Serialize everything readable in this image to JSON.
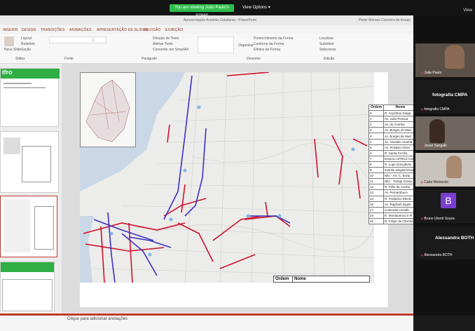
{
  "zoom": {
    "share_banner": "You are viewing João Paulo's screen",
    "view_options": "View Options",
    "view_corner": "View"
  },
  "window": {
    "doc_title": "Apresentação Avenida Cidadania - PowerPoint",
    "user_name": "Pieter Moraes Carneiro de Araujo"
  },
  "ribbon_tabs": [
    "INSERIR",
    "DESIGN",
    "TRANSIÇÕES",
    "ANIMAÇÕES",
    "APRESENTAÇÃO DE SLIDES",
    "REVISÃO",
    "EXIBIÇÃO"
  ],
  "ribbon": {
    "new_slide": "Novo Slide",
    "layout": "Layout",
    "reset": "Redefinir",
    "section": "Seção",
    "group_slides": "Slides",
    "group_font": "Fonte",
    "group_paragraph": "Parágrafo",
    "group_drawing": "Desenho",
    "group_editing": "Edição",
    "arrange": "Organizar",
    "find": "Localizar",
    "replace": "Substituir",
    "select": "Selecionar",
    "fill": "Preenchimento da Forma",
    "outline": "Contorno da Forma",
    "effects": "Efeitos de Forma",
    "text_direction": "Direção do Texto",
    "align_text": "Alinhar Texto",
    "smartart": "Converter em SmartArt"
  },
  "thumbnails": {
    "green_title": "ifro"
  },
  "slide": {
    "table": {
      "headers": [
        "Ordem",
        "Nome"
      ],
      "rows": [
        [
          "0",
          "R. Anysthas Sarga"
        ],
        [
          "1",
          "Av. João Pessoa"
        ],
        [
          "2",
          "Av. do Azenha"
        ],
        [
          "3",
          "Av. Borges de Med"
        ],
        [
          "4",
          "Av. Borges de Med"
        ],
        [
          "4",
          "Av. Osvaldo Aranha"
        ],
        [
          "5",
          "Av. Protásio Alves"
        ],
        [
          "6",
          "R. Santa Cecília"
        ],
        [
          "7",
          "Entorno UFRGS Car"
        ],
        [
          "8",
          "R. Lopo Gonçalves"
        ],
        [
          "9",
          "Getúlio Vargas/Vena"
        ],
        [
          "10",
          "Nilo - Art. C. Borta"
        ],
        [
          "11",
          "Nilo - Tiarajú Gonça"
        ],
        [
          "12",
          "R. Félix da Cunha"
        ],
        [
          "13",
          "Av. Pernambuco"
        ],
        [
          "14",
          "R. Frederico Mentz"
        ],
        [
          "15",
          "Av. Raphael Zippin"
        ],
        [
          "17",
          "Colonizial Cavalh"
        ],
        [
          "23",
          "R. Montaurinos e Fl"
        ],
        [
          "26",
          "R. Felipe de Oliveira"
        ]
      ]
    },
    "bottom_table_headers": [
      "Ordem",
      "Nome"
    ]
  },
  "notes_placeholder": "Clique para adicionar anotações",
  "participants": [
    {
      "name": "João Paulo"
    },
    {
      "name": "fotografia CMPA",
      "big": "fotografia CMPA"
    },
    {
      "name": "Jessé Sangalli"
    },
    {
      "name": "Carla Meinecke"
    },
    {
      "name": "Bruno Uberti Souza",
      "avatar": "B"
    },
    {
      "name": "Alessandra BOTH",
      "big": "Alessandra BOTH"
    }
  ],
  "colors": {
    "zoom_green": "#2fbf4a",
    "route_red": "#d0102a",
    "route_blue": "#3a2fc0",
    "thumb_green": "#2fae43",
    "avatar_purple": "#7a3fd0"
  }
}
